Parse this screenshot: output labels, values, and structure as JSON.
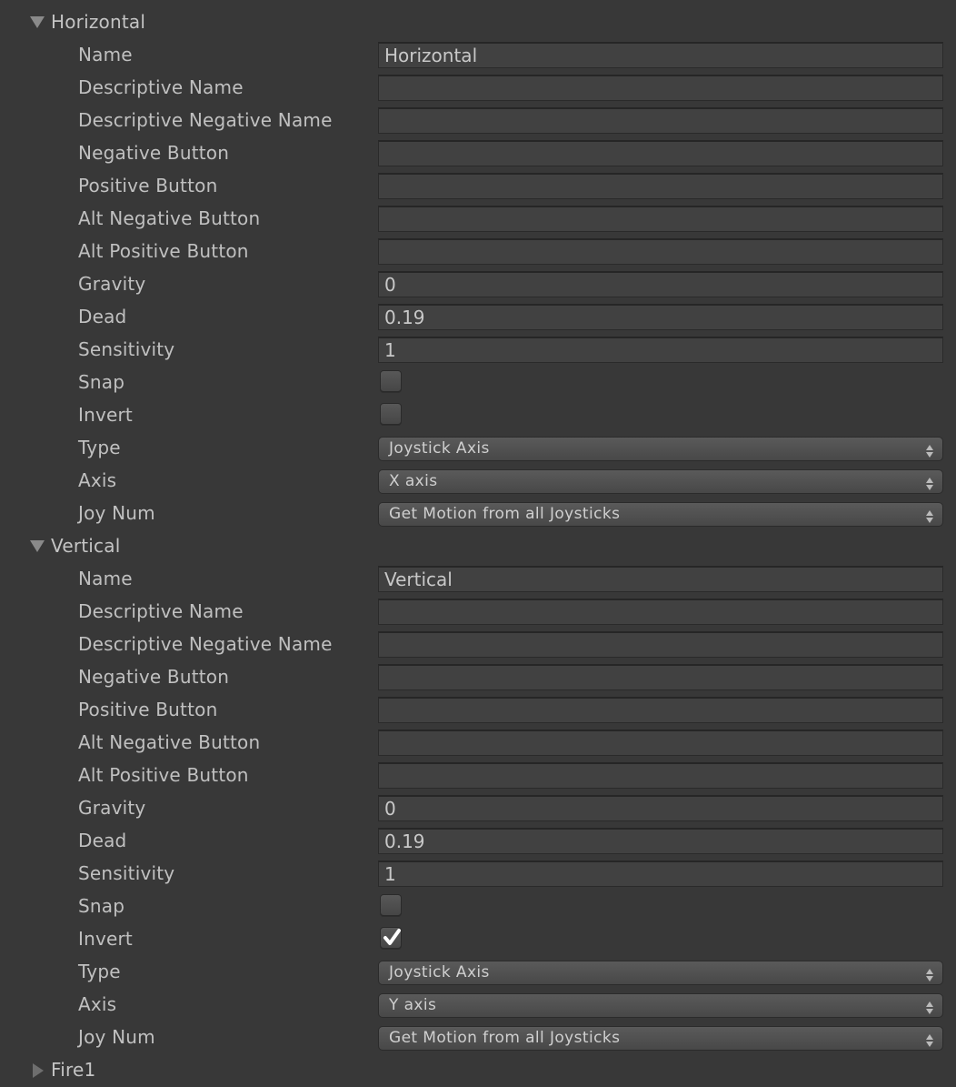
{
  "sections": [
    {
      "title": "Horizontal",
      "expanded": true,
      "rows": [
        {
          "label": "Name",
          "kind": "text",
          "value": "Horizontal"
        },
        {
          "label": "Descriptive Name",
          "kind": "text",
          "value": ""
        },
        {
          "label": "Descriptive Negative Name",
          "kind": "text",
          "value": ""
        },
        {
          "label": "Negative Button",
          "kind": "text",
          "value": ""
        },
        {
          "label": "Positive Button",
          "kind": "text",
          "value": ""
        },
        {
          "label": "Alt Negative Button",
          "kind": "text",
          "value": ""
        },
        {
          "label": "Alt Positive Button",
          "kind": "text",
          "value": ""
        },
        {
          "label": "Gravity",
          "kind": "text",
          "value": "0"
        },
        {
          "label": "Dead",
          "kind": "text",
          "value": "0.19"
        },
        {
          "label": "Sensitivity",
          "kind": "text",
          "value": "1"
        },
        {
          "label": "Snap",
          "kind": "checkbox",
          "checked": false
        },
        {
          "label": "Invert",
          "kind": "checkbox",
          "checked": false
        },
        {
          "label": "Type",
          "kind": "dropdown",
          "value": "Joystick Axis"
        },
        {
          "label": "Axis",
          "kind": "dropdown",
          "value": "X axis"
        },
        {
          "label": "Joy Num",
          "kind": "dropdown",
          "value": "Get Motion from all Joysticks"
        }
      ]
    },
    {
      "title": "Vertical",
      "expanded": true,
      "rows": [
        {
          "label": "Name",
          "kind": "text",
          "value": "Vertical"
        },
        {
          "label": "Descriptive Name",
          "kind": "text",
          "value": ""
        },
        {
          "label": "Descriptive Negative Name",
          "kind": "text",
          "value": ""
        },
        {
          "label": "Negative Button",
          "kind": "text",
          "value": ""
        },
        {
          "label": "Positive Button",
          "kind": "text",
          "value": ""
        },
        {
          "label": "Alt Negative Button",
          "kind": "text",
          "value": ""
        },
        {
          "label": "Alt Positive Button",
          "kind": "text",
          "value": ""
        },
        {
          "label": "Gravity",
          "kind": "text",
          "value": "0"
        },
        {
          "label": "Dead",
          "kind": "text",
          "value": "0.19"
        },
        {
          "label": "Sensitivity",
          "kind": "text",
          "value": "1"
        },
        {
          "label": "Snap",
          "kind": "checkbox",
          "checked": false
        },
        {
          "label": "Invert",
          "kind": "checkbox",
          "checked": true
        },
        {
          "label": "Type",
          "kind": "dropdown",
          "value": "Joystick Axis"
        },
        {
          "label": "Axis",
          "kind": "dropdown",
          "value": "Y axis"
        },
        {
          "label": "Joy Num",
          "kind": "dropdown",
          "value": "Get Motion from all Joysticks"
        }
      ]
    },
    {
      "title": "Fire1",
      "expanded": false,
      "rows": []
    }
  ],
  "colors": {
    "background": "#383838",
    "field": "#414141",
    "text": "#c2c2c2"
  }
}
